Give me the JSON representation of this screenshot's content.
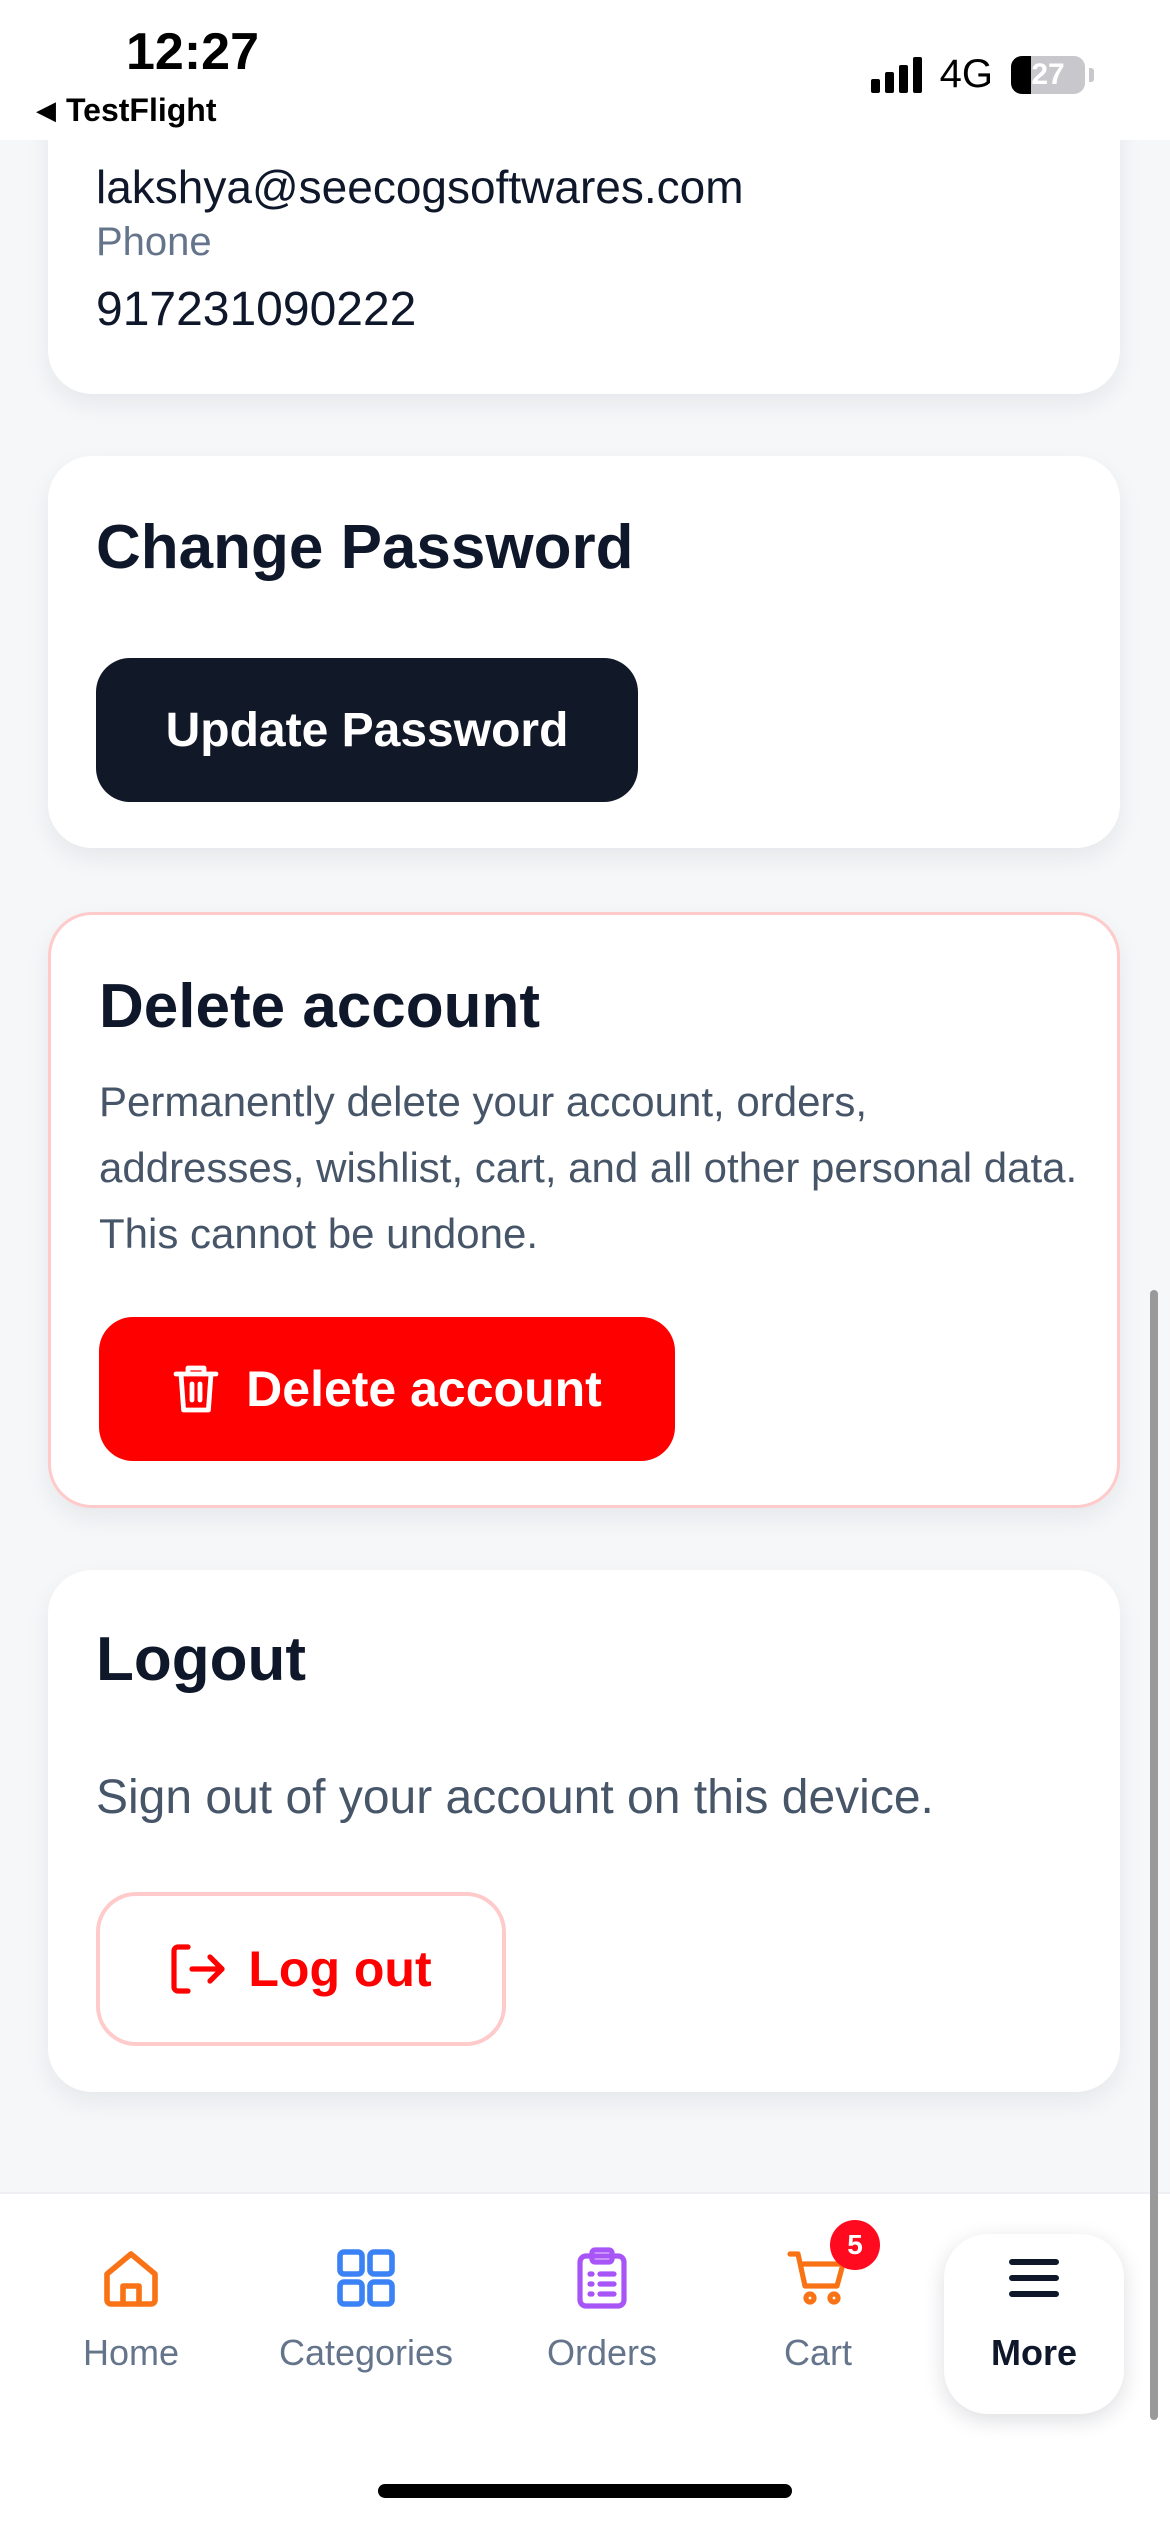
{
  "status_bar": {
    "time": "12:27",
    "back_app": "TestFlight",
    "network": "4G",
    "battery": "27",
    "battery_level": 0.27
  },
  "profile": {
    "email_partial": "lakshya@seecogsoftwares.com",
    "phone_label": "Phone",
    "phone_value": "917231090222"
  },
  "change_password": {
    "title": "Change Password",
    "button_label": "Update Password"
  },
  "delete_account": {
    "title": "Delete account",
    "description": "Permanently delete your account, orders, addresses, wishlist, cart, and all other personal data. This cannot be undone.",
    "button_label": "Delete account",
    "button_icon": "trash-icon"
  },
  "logout": {
    "title": "Logout",
    "description": "Sign out of your account on this device.",
    "button_label": "Log out",
    "button_icon": "logout-icon"
  },
  "bottom_nav": {
    "items": [
      {
        "label": "Home",
        "icon": "home-icon",
        "color": "#f97316"
      },
      {
        "label": "Categories",
        "icon": "grid-icon",
        "color": "#3b82f6"
      },
      {
        "label": "Orders",
        "icon": "clipboard-icon",
        "color": "#a855f7"
      },
      {
        "label": "Cart",
        "icon": "cart-icon",
        "color": "#f97316",
        "badge": "5"
      },
      {
        "label": "More",
        "icon": "menu-icon",
        "color": "#0f172a",
        "active": true
      }
    ]
  },
  "colors": {
    "danger": "#ff0000",
    "dark_button": "#111827",
    "danger_border": "#fecaca"
  }
}
